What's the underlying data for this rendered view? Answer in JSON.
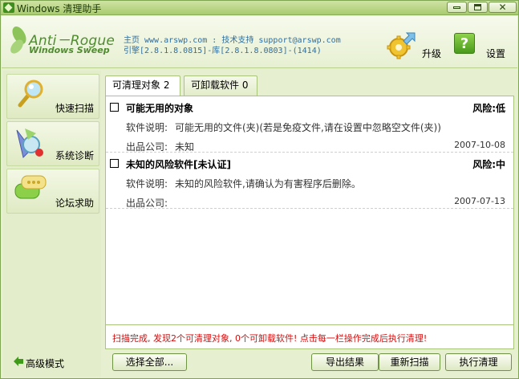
{
  "window": {
    "title": "Windows 清理助手"
  },
  "header": {
    "logo_main": "Anti－Rogue",
    "logo_sub": "Windows Sweep",
    "info_line1": "主页 www.arswp.com : 技术支持 support@arswp.com",
    "info_line2": "引擎[2.8.1.8.0815]-库[2.8.1.8.0803]-(1414)",
    "upgrade_label": "升级",
    "settings_label": "设置",
    "settings_icon_glyph": "?"
  },
  "sidebar": {
    "items": [
      {
        "label": "快速扫描",
        "icon": "magnifier-icon"
      },
      {
        "label": "系统诊断",
        "icon": "diagnose-icon"
      },
      {
        "label": "论坛求助",
        "icon": "chat-bubble-icon"
      }
    ],
    "advanced_mode": "高级模式"
  },
  "tabs": [
    {
      "label": "可清理对象 2",
      "active": true
    },
    {
      "label": "可卸载软件 0",
      "active": false
    }
  ],
  "entries": [
    {
      "name": "可能无用的对象",
      "risk": "风险:低",
      "desc_label": "软件说明:",
      "desc": "可能无用的文件(夹)(若是免疫文件,请在设置中忽略空文件(夹))",
      "company_label": "出品公司:",
      "company": "未知",
      "date": "2007-10-08"
    },
    {
      "name": "未知的风险软件[未认证]",
      "risk": "风险:中",
      "desc_label": "软件说明:",
      "desc": "未知的风险软件,请确认为有害程序后删除。",
      "company_label": "出品公司:",
      "company": "",
      "date": "2007-07-13"
    }
  ],
  "status": {
    "text": "扫描完成, 发现2个可清理对象, 0个可卸载软件! 点击每一栏操作完成后执行清理!"
  },
  "buttons": {
    "select_all": "选择全部...",
    "export": "导出结果",
    "rescan": "重新扫描",
    "clean": "执行清理"
  },
  "colors": {
    "accent": "#4f8b2f",
    "status_red": "#d01010",
    "link_blue": "#2e6ea0"
  }
}
